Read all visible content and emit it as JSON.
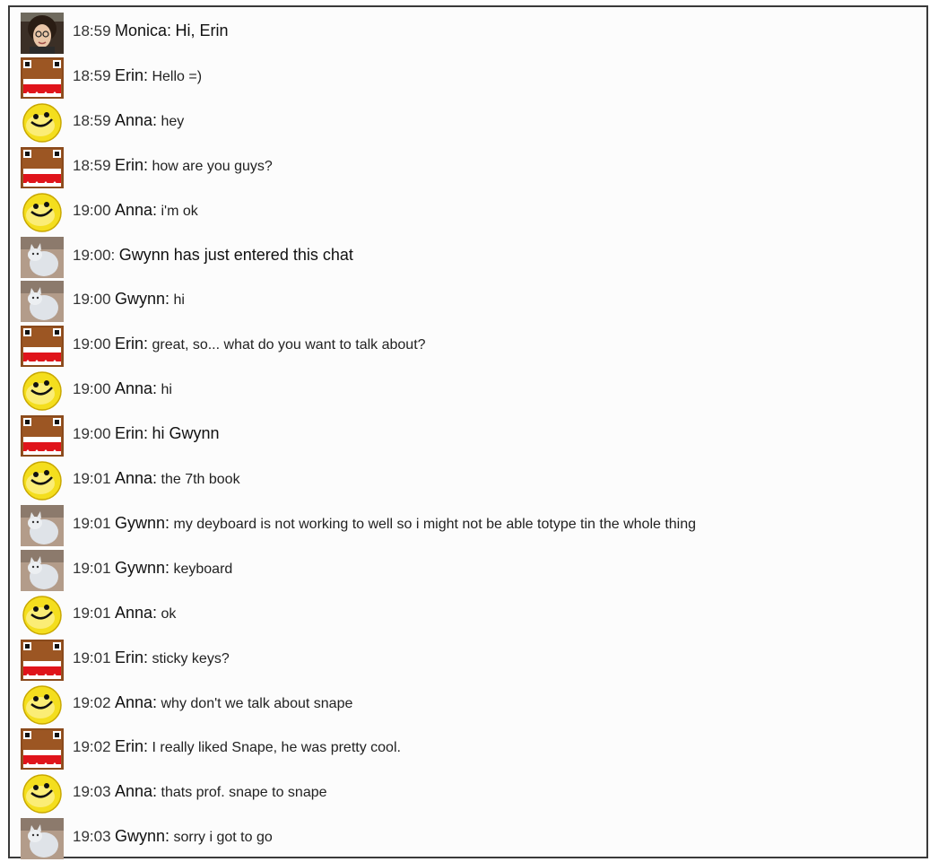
{
  "chat": {
    "messages": [
      {
        "avatar": "photo-avatar",
        "time": "18:59",
        "sender": "Monica:",
        "text": "Hi, Erin",
        "big": true
      },
      {
        "avatar": "domo-avatar",
        "time": "18:59",
        "sender": "Erin:",
        "text": "Hello =)",
        "big": false
      },
      {
        "avatar": "smiley-avatar",
        "time": "18:59",
        "sender": "Anna:",
        "text": "hey",
        "big": false
      },
      {
        "avatar": "domo-avatar",
        "time": "18:59",
        "sender": "Erin:",
        "text": "how are you guys?",
        "big": false
      },
      {
        "avatar": "smiley-avatar",
        "time": "19:00",
        "sender": "Anna:",
        "text": "i'm ok",
        "big": false
      },
      {
        "avatar": "cat-avatar",
        "time": "19:00:",
        "sender": "",
        "text": "Gwynn has just entered this chat",
        "big": true
      },
      {
        "avatar": "cat-avatar",
        "time": "19:00",
        "sender": "Gwynn:",
        "text": "hi",
        "big": false
      },
      {
        "avatar": "domo-avatar",
        "time": "19:00",
        "sender": "Erin:",
        "text": "great, so... what do you want to talk about?",
        "big": false
      },
      {
        "avatar": "smiley-avatar",
        "time": "19:00",
        "sender": "Anna:",
        "text": "hi",
        "big": false
      },
      {
        "avatar": "domo-avatar",
        "time": "19:00",
        "sender": "Erin:",
        "text": "hi Gwynn",
        "big": true
      },
      {
        "avatar": "smiley-avatar",
        "time": "19:01",
        "sender": "Anna:",
        "text": "the 7th book",
        "big": false
      },
      {
        "avatar": "cat-avatar",
        "time": "19:01",
        "sender": "Gywnn:",
        "text": "my deyboard is not working to well so i might not be able totype tin the whole thing",
        "big": false
      },
      {
        "avatar": "cat-avatar",
        "time": "19:01",
        "sender": "Gywnn:",
        "text": "keyboard",
        "big": false
      },
      {
        "avatar": "smiley-avatar",
        "time": "19:01",
        "sender": "Anna:",
        "text": "ok",
        "big": false
      },
      {
        "avatar": "domo-avatar",
        "time": "19:01",
        "sender": "Erin:",
        "text": "sticky keys?",
        "big": false
      },
      {
        "avatar": "smiley-avatar",
        "time": "19:02",
        "sender": "Anna:",
        "text": "why don't we talk about snape",
        "big": false
      },
      {
        "avatar": "domo-avatar",
        "time": "19:02",
        "sender": "Erin:",
        "text": "I really liked Snape, he was pretty cool.",
        "big": false
      },
      {
        "avatar": "smiley-avatar",
        "time": "19:03",
        "sender": "Anna:",
        "text": "thats prof. snape to snape",
        "big": false
      },
      {
        "avatar": "cat-avatar",
        "time": "19:03",
        "sender": "Gwynn:",
        "text": "sorry i got to go",
        "big": false
      }
    ]
  }
}
